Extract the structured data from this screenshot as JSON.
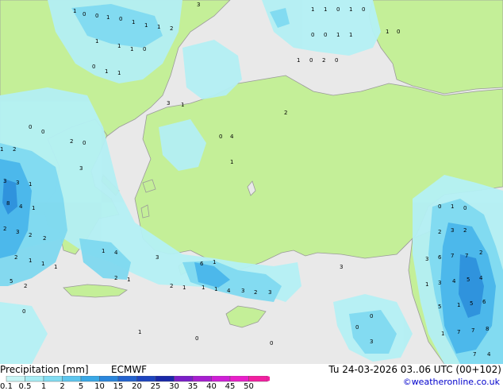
{
  "map": {
    "colors": {
      "sea": "#e9e9e9",
      "land": "#c4ef98",
      "precip_light": "#b4f0f4",
      "precip_mid": "#7fd9f0",
      "precip_heavy": "#49b6ea",
      "precip_strong": "#2c8fdc",
      "coast": "#9a9a9a"
    },
    "value_labels": [
      "0",
      "1",
      "2",
      "3",
      "4",
      "5",
      "6",
      "7",
      "8"
    ]
  },
  "legend": {
    "title": "Precipitation [mm]",
    "model": "ECMWF",
    "ticks": [
      "0.1",
      "0.5",
      "1",
      "2",
      "5",
      "10",
      "15",
      "20",
      "25",
      "30",
      "35",
      "40",
      "45",
      "50"
    ],
    "colors": [
      "#c8f5f5",
      "#a6ecf4",
      "#82dcf1",
      "#5ec6ee",
      "#3aa8e6",
      "#2a86dc",
      "#2463cf",
      "#1e45bf",
      "#1a28a8",
      "#7b1fc8",
      "#a71fd0",
      "#cf1fd6",
      "#e91fc9",
      "#f21fa0"
    ]
  },
  "valid_time": "Tu 24-03-2026 03..06 UTC (00+102)",
  "credit": "©weatheronline.co.uk"
}
